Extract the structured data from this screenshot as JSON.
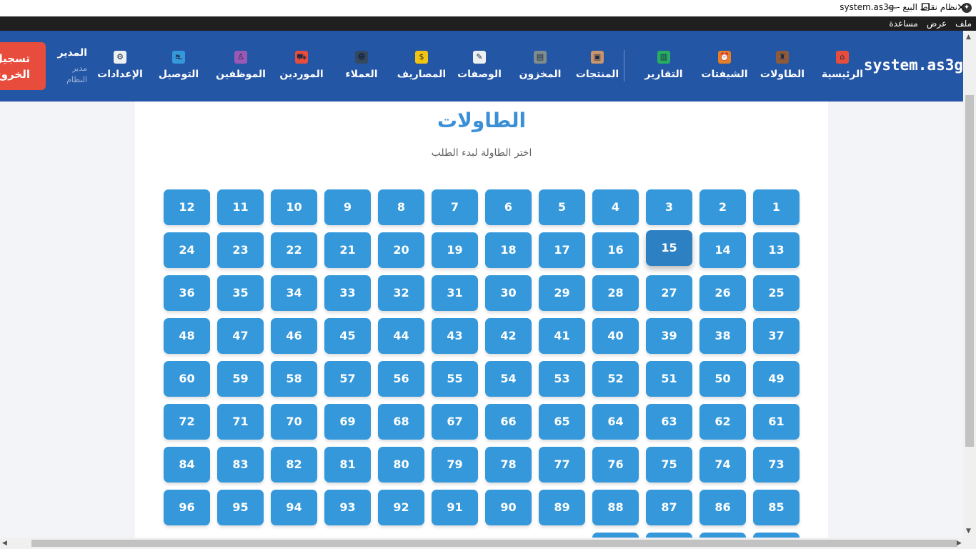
{
  "window": {
    "title": "نظام نقاط البيع - system.as3g",
    "buttons": [
      {
        "name": "minimize-button",
        "glyph": "—"
      },
      {
        "name": "restore-button",
        "glyph": "❐"
      },
      {
        "name": "close-button",
        "glyph": "✕"
      }
    ]
  },
  "menubar": {
    "items": [
      "ملف",
      "عرض",
      "مساعدة"
    ]
  },
  "header": {
    "brand": "system.as3g",
    "nav": [
      {
        "label": "الرئيسية",
        "icon": "home-icon",
        "glyph": "⌂",
        "color": "#e74c3c"
      },
      {
        "label": "الطاولات",
        "icon": "chair-icon",
        "glyph": "♜",
        "color": "#8e5a3a"
      },
      {
        "label": "الشيفتات",
        "icon": "alarm-clock-icon",
        "glyph": "⏰",
        "color": "#e67e22"
      },
      {
        "label": "التقارير",
        "icon": "bar-chart-icon",
        "glyph": "▥",
        "color": "#27ae60"
      },
      {
        "label": "المنتجات",
        "icon": "package-icon",
        "glyph": "▣",
        "color": "#c8956c"
      },
      {
        "label": "المخزون",
        "icon": "cash-register-icon",
        "glyph": "▤",
        "color": "#7f8c8d"
      },
      {
        "label": "الوصفات",
        "icon": "memo-icon",
        "glyph": "✎",
        "color": "#ecf0f1"
      },
      {
        "label": "المصاريف",
        "icon": "money-bag-icon",
        "glyph": "$",
        "color": "#f1c40f"
      },
      {
        "label": "العملاء",
        "icon": "users-icon",
        "glyph": "☻",
        "color": "#34495e"
      },
      {
        "label": "الموردين",
        "icon": "truck-icon",
        "glyph": "⛟",
        "color": "#e74c3c"
      },
      {
        "label": "الموظفين",
        "icon": "employee-icon",
        "glyph": "♙",
        "color": "#9b59b6"
      },
      {
        "label": "التوصيل",
        "icon": "delivery-scooter-icon",
        "glyph": "⛐",
        "color": "#3498db"
      },
      {
        "label": "الإعدادات",
        "icon": "gear-icon",
        "glyph": "⚙",
        "color": "#ecf0f1"
      }
    ],
    "user": {
      "name": "المدير",
      "role": "مدير النظام"
    },
    "logout_label": "تسجيل الخروج"
  },
  "main": {
    "title": "الطاولات",
    "subtitle": "اختر الطاولة لبدء الطلب",
    "active_table": 15,
    "tables": [
      1,
      2,
      3,
      4,
      5,
      6,
      7,
      8,
      9,
      10,
      11,
      12,
      13,
      14,
      15,
      16,
      17,
      18,
      19,
      20,
      21,
      22,
      23,
      24,
      25,
      26,
      27,
      28,
      29,
      30,
      31,
      32,
      33,
      34,
      35,
      36,
      37,
      38,
      39,
      40,
      41,
      42,
      43,
      44,
      45,
      46,
      47,
      48,
      49,
      50,
      51,
      52,
      53,
      54,
      55,
      56,
      57,
      58,
      59,
      60,
      61,
      62,
      63,
      64,
      65,
      66,
      67,
      68,
      69,
      70,
      71,
      72,
      73,
      74,
      75,
      76,
      77,
      78,
      79,
      80,
      81,
      82,
      83,
      84,
      85,
      86,
      87,
      88,
      89,
      90,
      91,
      92,
      93,
      94,
      95,
      96
    ]
  },
  "colors": {
    "header_bg": "#2456a6",
    "table_button": "#3498db",
    "table_active": "#2d80c1",
    "title": "#3a8fd6",
    "logout": "#e74c3c"
  }
}
